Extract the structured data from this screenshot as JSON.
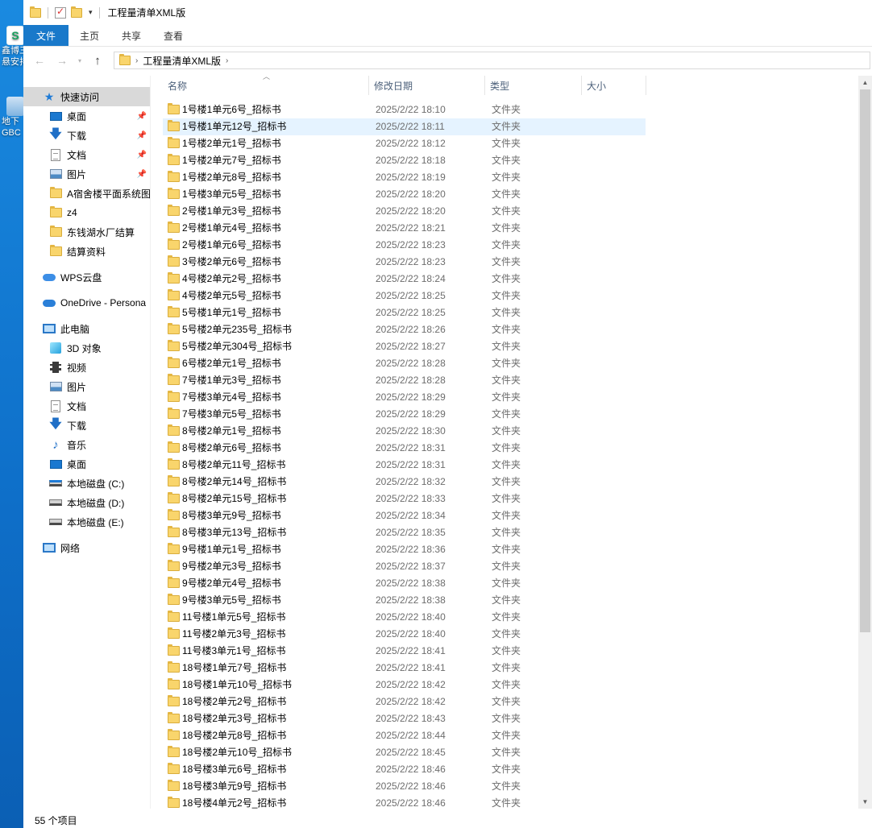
{
  "desktop": {
    "icons": [
      {
        "label_1": "鑫博三",
        "label_2": "悬安排"
      },
      {
        "label_1": "地下",
        "label_2": "GBC"
      }
    ]
  },
  "window": {
    "title": "工程量清单XML版"
  },
  "ribbon": {
    "tabs": [
      "文件",
      "主页",
      "共享",
      "查看"
    ]
  },
  "address": {
    "path": [
      "工程量清单XML版"
    ]
  },
  "nav": {
    "quick_access": "快速访问",
    "pinned": [
      "桌面",
      "下载",
      "文档",
      "图片"
    ],
    "recent": [
      "A宿舍楼平面系统图",
      "z4",
      "东钱湖水厂结算",
      "结算资料"
    ],
    "wps_cloud": "WPS云盘",
    "onedrive": "OneDrive - Persona",
    "this_pc": "此电脑",
    "pc_items": [
      "3D 对象",
      "视频",
      "图片",
      "文档",
      "下载",
      "音乐",
      "桌面",
      "本地磁盘 (C:)",
      "本地磁盘 (D:)",
      "本地磁盘 (E:)"
    ],
    "network": "网络"
  },
  "list": {
    "columns": {
      "name": "名称",
      "modified": "修改日期",
      "type": "类型",
      "size": "大小"
    },
    "selected_index": 1,
    "rows": [
      {
        "name": "1号楼1单元6号_招标书",
        "date": "2025/2/22 18:10",
        "type": "文件夹"
      },
      {
        "name": "1号楼1单元12号_招标书",
        "date": "2025/2/22 18:11",
        "type": "文件夹"
      },
      {
        "name": "1号楼2单元1号_招标书",
        "date": "2025/2/22 18:12",
        "type": "文件夹"
      },
      {
        "name": "1号楼2单元7号_招标书",
        "date": "2025/2/22 18:18",
        "type": "文件夹"
      },
      {
        "name": "1号楼2单元8号_招标书",
        "date": "2025/2/22 18:19",
        "type": "文件夹"
      },
      {
        "name": "1号楼3单元5号_招标书",
        "date": "2025/2/22 18:20",
        "type": "文件夹"
      },
      {
        "name": "2号楼1单元3号_招标书",
        "date": "2025/2/22 18:20",
        "type": "文件夹"
      },
      {
        "name": "2号楼1单元4号_招标书",
        "date": "2025/2/22 18:21",
        "type": "文件夹"
      },
      {
        "name": "2号楼1单元6号_招标书",
        "date": "2025/2/22 18:23",
        "type": "文件夹"
      },
      {
        "name": "3号楼2单元6号_招标书",
        "date": "2025/2/22 18:23",
        "type": "文件夹"
      },
      {
        "name": "4号楼2单元2号_招标书",
        "date": "2025/2/22 18:24",
        "type": "文件夹"
      },
      {
        "name": "4号楼2单元5号_招标书",
        "date": "2025/2/22 18:25",
        "type": "文件夹"
      },
      {
        "name": "5号楼1单元1号_招标书",
        "date": "2025/2/22 18:25",
        "type": "文件夹"
      },
      {
        "name": "5号楼2单元235号_招标书",
        "date": "2025/2/22 18:26",
        "type": "文件夹"
      },
      {
        "name": "5号楼2单元304号_招标书",
        "date": "2025/2/22 18:27",
        "type": "文件夹"
      },
      {
        "name": "6号楼2单元1号_招标书",
        "date": "2025/2/22 18:28",
        "type": "文件夹"
      },
      {
        "name": "7号楼1单元3号_招标书",
        "date": "2025/2/22 18:28",
        "type": "文件夹"
      },
      {
        "name": "7号楼3单元4号_招标书",
        "date": "2025/2/22 18:29",
        "type": "文件夹"
      },
      {
        "name": "7号楼3单元5号_招标书",
        "date": "2025/2/22 18:29",
        "type": "文件夹"
      },
      {
        "name": "8号楼2单元1号_招标书",
        "date": "2025/2/22 18:30",
        "type": "文件夹"
      },
      {
        "name": "8号楼2单元6号_招标书",
        "date": "2025/2/22 18:31",
        "type": "文件夹"
      },
      {
        "name": "8号楼2单元11号_招标书",
        "date": "2025/2/22 18:31",
        "type": "文件夹"
      },
      {
        "name": "8号楼2单元14号_招标书",
        "date": "2025/2/22 18:32",
        "type": "文件夹"
      },
      {
        "name": "8号楼2单元15号_招标书",
        "date": "2025/2/22 18:33",
        "type": "文件夹"
      },
      {
        "name": "8号楼3单元9号_招标书",
        "date": "2025/2/22 18:34",
        "type": "文件夹"
      },
      {
        "name": "8号楼3单元13号_招标书",
        "date": "2025/2/22 18:35",
        "type": "文件夹"
      },
      {
        "name": "9号楼1单元1号_招标书",
        "date": "2025/2/22 18:36",
        "type": "文件夹"
      },
      {
        "name": "9号楼2单元3号_招标书",
        "date": "2025/2/22 18:37",
        "type": "文件夹"
      },
      {
        "name": "9号楼2单元4号_招标书",
        "date": "2025/2/22 18:38",
        "type": "文件夹"
      },
      {
        "name": "9号楼3单元5号_招标书",
        "date": "2025/2/22 18:38",
        "type": "文件夹"
      },
      {
        "name": "11号楼1单元5号_招标书",
        "date": "2025/2/22 18:40",
        "type": "文件夹"
      },
      {
        "name": "11号楼2单元3号_招标书",
        "date": "2025/2/22 18:40",
        "type": "文件夹"
      },
      {
        "name": "11号楼3单元1号_招标书",
        "date": "2025/2/22 18:41",
        "type": "文件夹"
      },
      {
        "name": "18号楼1单元7号_招标书",
        "date": "2025/2/22 18:41",
        "type": "文件夹"
      },
      {
        "name": "18号楼1单元10号_招标书",
        "date": "2025/2/22 18:42",
        "type": "文件夹"
      },
      {
        "name": "18号楼2单元2号_招标书",
        "date": "2025/2/22 18:42",
        "type": "文件夹"
      },
      {
        "name": "18号楼2单元3号_招标书",
        "date": "2025/2/22 18:43",
        "type": "文件夹"
      },
      {
        "name": "18号楼2单元8号_招标书",
        "date": "2025/2/22 18:44",
        "type": "文件夹"
      },
      {
        "name": "18号楼2单元10号_招标书",
        "date": "2025/2/22 18:45",
        "type": "文件夹"
      },
      {
        "name": "18号楼3单元6号_招标书",
        "date": "2025/2/22 18:46",
        "type": "文件夹"
      },
      {
        "name": "18号楼3单元9号_招标书",
        "date": "2025/2/22 18:46",
        "type": "文件夹"
      },
      {
        "name": "18号楼4单元2号_招标书",
        "date": "2025/2/22 18:46",
        "type": "文件夹"
      }
    ]
  },
  "status": {
    "item_count": "55 个项目"
  },
  "colors": {
    "accent": "#1979ca",
    "selection": "#e5f3ff",
    "folder": "#f9d56c"
  }
}
